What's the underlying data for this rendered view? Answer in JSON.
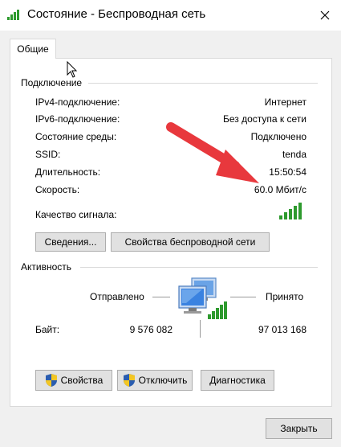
{
  "window": {
    "title": "Состояние - Беспроводная сеть"
  },
  "tabs": [
    {
      "label": "Общие"
    }
  ],
  "connection": {
    "title": "Подключение",
    "rows": [
      {
        "label": "IPv4-подключение:",
        "value": "Интернет"
      },
      {
        "label": "IPv6-подключение:",
        "value": "Без доступа к сети"
      },
      {
        "label": "Состояние среды:",
        "value": "Подключено"
      },
      {
        "label": "SSID:",
        "value": "tenda"
      },
      {
        "label": "Длительность:",
        "value": "15:50:54"
      },
      {
        "label": "Скорость:",
        "value": "60.0 Мбит/с"
      }
    ],
    "signal_label": "Качество сигнала:",
    "signal_bars": 5,
    "details_button": "Сведения...",
    "wireless_props_button": "Свойства беспроводной сети"
  },
  "activity": {
    "title": "Активность",
    "sent_label": "Отправлено",
    "received_label": "Принято",
    "bytes_label": "Байт:",
    "bytes_sent": "9 576 082",
    "bytes_received": "97 013 168"
  },
  "buttons": {
    "properties": "Свойства",
    "disconnect": "Отключить",
    "diagnostics": "Диагностика",
    "close": "Закрыть"
  },
  "colors": {
    "signal_green": "#2e9a2e",
    "arrow_red": "#e8383d",
    "shield_blue": "#2a5db0",
    "shield_yellow": "#f3c623"
  }
}
